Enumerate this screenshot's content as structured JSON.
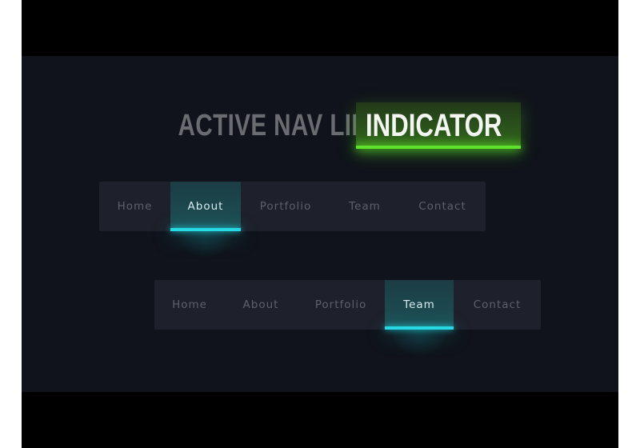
{
  "title": {
    "plain_text": "ACTIVE NAV LINK",
    "highlight_text": "INDICATOR",
    "highlight_color": "#5fe22c"
  },
  "colors": {
    "background": "#10131b",
    "nav_background": "#1e212c",
    "active_accent": "#27d9e4",
    "inactive_text": "#5d606b",
    "active_text": "#d7ecee"
  },
  "navs": [
    {
      "items": [
        {
          "label": "Home",
          "active": false
        },
        {
          "label": "About",
          "active": true
        },
        {
          "label": "Portfolio",
          "active": false
        },
        {
          "label": "Team",
          "active": false
        },
        {
          "label": "Contact",
          "active": false
        }
      ]
    },
    {
      "items": [
        {
          "label": "Home",
          "active": false
        },
        {
          "label": "About",
          "active": false
        },
        {
          "label": "Portfolio",
          "active": false
        },
        {
          "label": "Team",
          "active": true
        },
        {
          "label": "Contact",
          "active": false
        }
      ]
    }
  ]
}
